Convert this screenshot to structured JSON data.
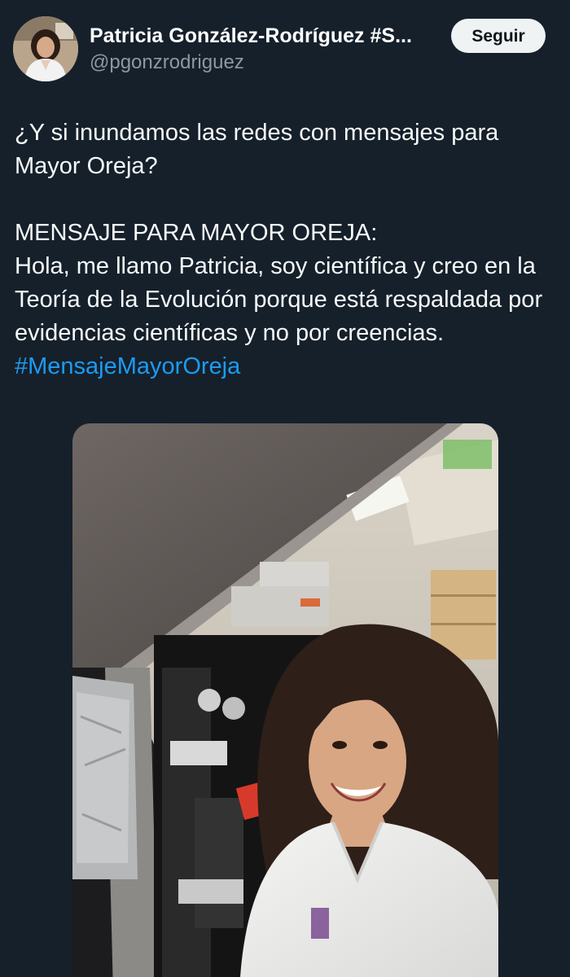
{
  "author": {
    "name": "Patricia González-Rodríguez #S...",
    "handle": "@pgonzrodriguez",
    "avatar_icon": "profile-photo"
  },
  "follow_button": {
    "label": "Seguir"
  },
  "tweet": {
    "line1": "¿Y si inundamos las redes con mensajes para Mayor Oreja?",
    "heading": "MENSAJE PARA MAYOR OREJA:",
    "body": "Hola, me llamo Patricia, soy científica y creo en la Teoría de la Evolución porque está respaldada por evidencias científicas y no por creencias.",
    "hashtag": "#MensajeMayorOreja"
  },
  "media": {
    "icon": "lab-selfie-photo"
  },
  "colors": {
    "background": "#15202b",
    "text": "#f7f9f9",
    "secondary_text": "#8b98a5",
    "link": "#1d9bf0",
    "button_bg": "#eff3f4",
    "button_text": "#0f1419"
  }
}
